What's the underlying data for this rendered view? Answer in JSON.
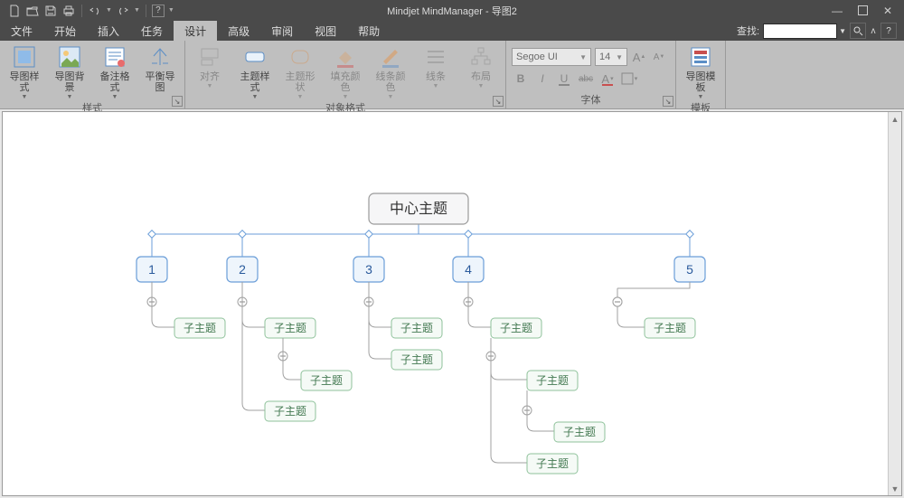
{
  "app": {
    "title": "Mindjet MindManager - 导图2"
  },
  "menu": {
    "items": [
      "文件",
      "开始",
      "插入",
      "任务",
      "设计",
      "高级",
      "审阅",
      "视图",
      "帮助"
    ],
    "active_index": 4
  },
  "search": {
    "label": "查找:"
  },
  "ribbon": {
    "style": {
      "group_name": "样式",
      "map_styles": "导图样式",
      "map_bg": "导图背景",
      "note_styles": "备注格式",
      "balance": "平衡导图"
    },
    "objfmt": {
      "group_name": "对象格式",
      "apply": "对齐",
      "topic_style": "主题样式",
      "topic_shape": "主题形状",
      "fill": "填充颜色",
      "line_color": "线条颜色",
      "lines": "线条",
      "layout": "布局"
    },
    "font": {
      "group_name": "字体",
      "family": "Segoe UI",
      "size": "14",
      "grow": "A",
      "shrink": "A",
      "bold": "B",
      "italic": "I",
      "underline": "U",
      "strike": "abc"
    },
    "template": {
      "group_name": "模板",
      "btn": "导图模板"
    }
  },
  "map": {
    "central": "中心主题",
    "sub": "子主题",
    "branches": {
      "n1": "1",
      "n2": "2",
      "n3": "3",
      "n4": "4",
      "n5": "5"
    }
  }
}
